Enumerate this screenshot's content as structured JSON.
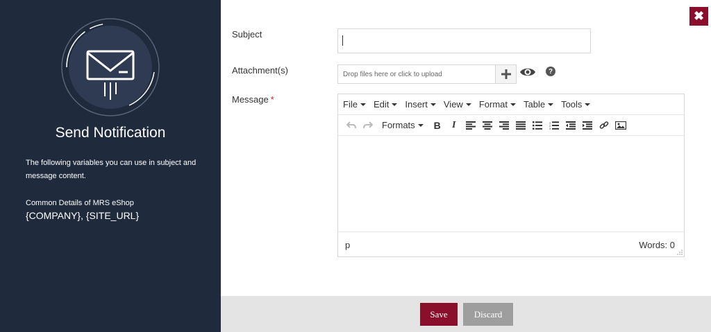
{
  "sidebar": {
    "title": "Send Notification",
    "description": "The following variables you can use in subject and message content.",
    "common_label": "Common Details of MRS eShop",
    "variables": "{COMPANY}, {SITE_URL}"
  },
  "form": {
    "subject_label": "Subject",
    "subject_value": "",
    "attachments_label": "Attachment(s)",
    "drop_placeholder": "Drop files here or click to upload",
    "message_label": "Message",
    "required_mark": "*"
  },
  "editor": {
    "menu": [
      "File",
      "Edit",
      "Insert",
      "View",
      "Format",
      "Table",
      "Tools"
    ],
    "formats_label": "Formats",
    "path": "p",
    "word_count": "Words: 0"
  },
  "footer": {
    "save_label": "Save",
    "discard_label": "Discard"
  },
  "close_glyph": "✖",
  "colors": {
    "sidebar_bg": "#1f2a3d",
    "accent": "#8a0f2c",
    "discard": "#9e9e9e"
  },
  "icons": [
    "envelope-icon",
    "close-icon",
    "plus-icon",
    "eye-icon",
    "help-icon",
    "undo-icon",
    "redo-icon",
    "bold-icon",
    "italic-icon",
    "align-left-icon",
    "align-center-icon",
    "align-right-icon",
    "align-justify-icon",
    "bullet-list-icon",
    "numbered-list-icon",
    "outdent-icon",
    "indent-icon",
    "link-icon",
    "image-icon"
  ]
}
